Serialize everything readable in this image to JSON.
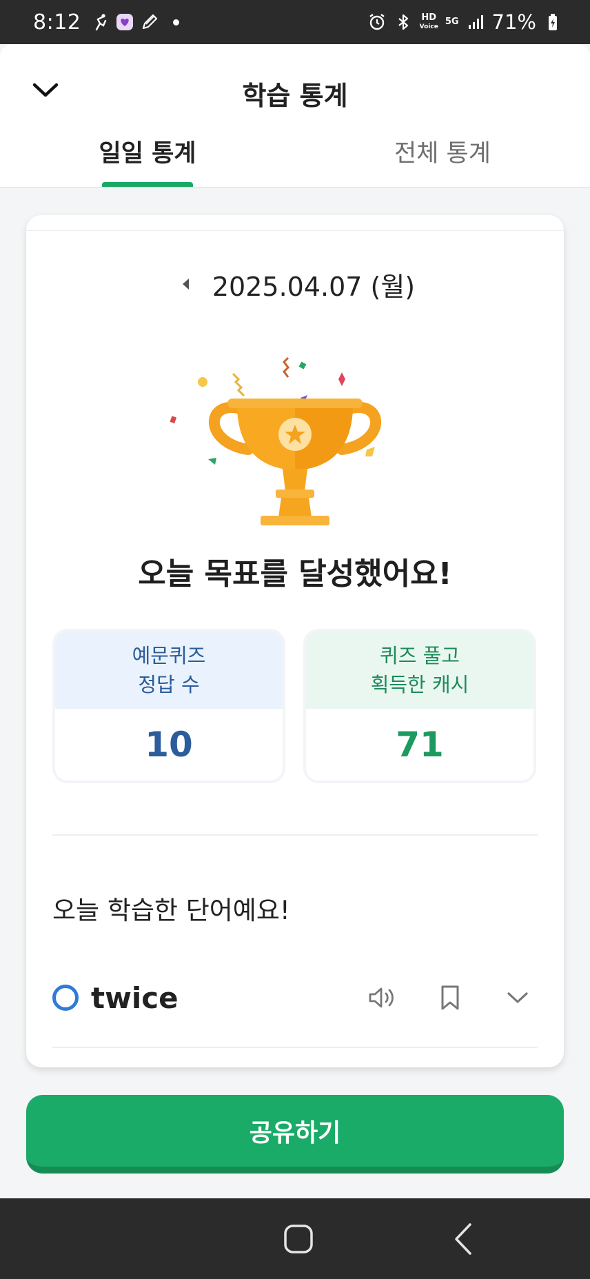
{
  "status_bar": {
    "time": "8:12",
    "left_icons": [
      "runner-icon",
      "heart-app-icon",
      "pencil-icon"
    ],
    "network": "HD",
    "network_sub": "Voice",
    "signal_label": "5G",
    "battery": "71%"
  },
  "header": {
    "title": "학습 통계",
    "tabs": [
      {
        "label": "일일 통계",
        "active": true
      },
      {
        "label": "전체 통계",
        "active": false
      }
    ]
  },
  "card": {
    "date": "2025.04.07 (월)",
    "goal_message": "오늘 목표를 달성했어요!",
    "stats": [
      {
        "label_line1": "예문퀴즈",
        "label_line2": "정답 수",
        "value": "10"
      },
      {
        "label_line1": "퀴즈 풀고",
        "label_line2": "획득한 캐시",
        "value": "71"
      }
    ],
    "section_title": "오늘 학습한 단어예요!",
    "words": [
      {
        "word": "twice"
      }
    ]
  },
  "share_button": {
    "label": "공유하기"
  },
  "colors": {
    "accent_green": "#1bab68",
    "stat_blue": "#2b5d9b",
    "stat_green": "#1c9a60",
    "trophy_gold": "#f7a51b"
  }
}
